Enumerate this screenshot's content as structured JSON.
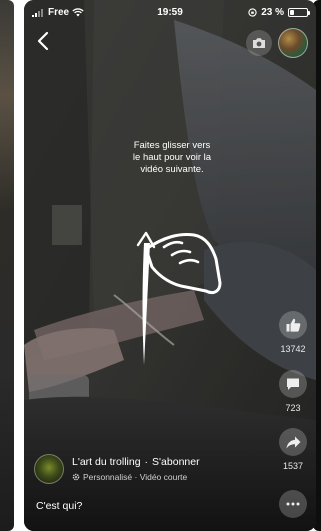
{
  "status_bar": {
    "carrier": "Free",
    "time": "19:59",
    "battery_text": "23 %",
    "battery_level_percent": 23
  },
  "header": {
    "back_icon": "chevron-left-icon",
    "camera_icon": "camera-icon"
  },
  "swipe_hint": {
    "text": "Faites glisser vers\nle haut pour voir la\nvidéo suivante.",
    "icon": "swipe-up-hand-icon"
  },
  "actions": {
    "like_count": "13742",
    "comment_count": "723",
    "share_count": "1537"
  },
  "author": {
    "name": "L'art du trolling",
    "separator": "·",
    "follow_label": "S'abonner",
    "subtitle": "Personnalisé · Vidéo courte"
  },
  "caption": "C'est qui?",
  "colors": {
    "overlay_text": "#ffffff",
    "action_circle": "rgba(255,255,255,0.22)"
  }
}
